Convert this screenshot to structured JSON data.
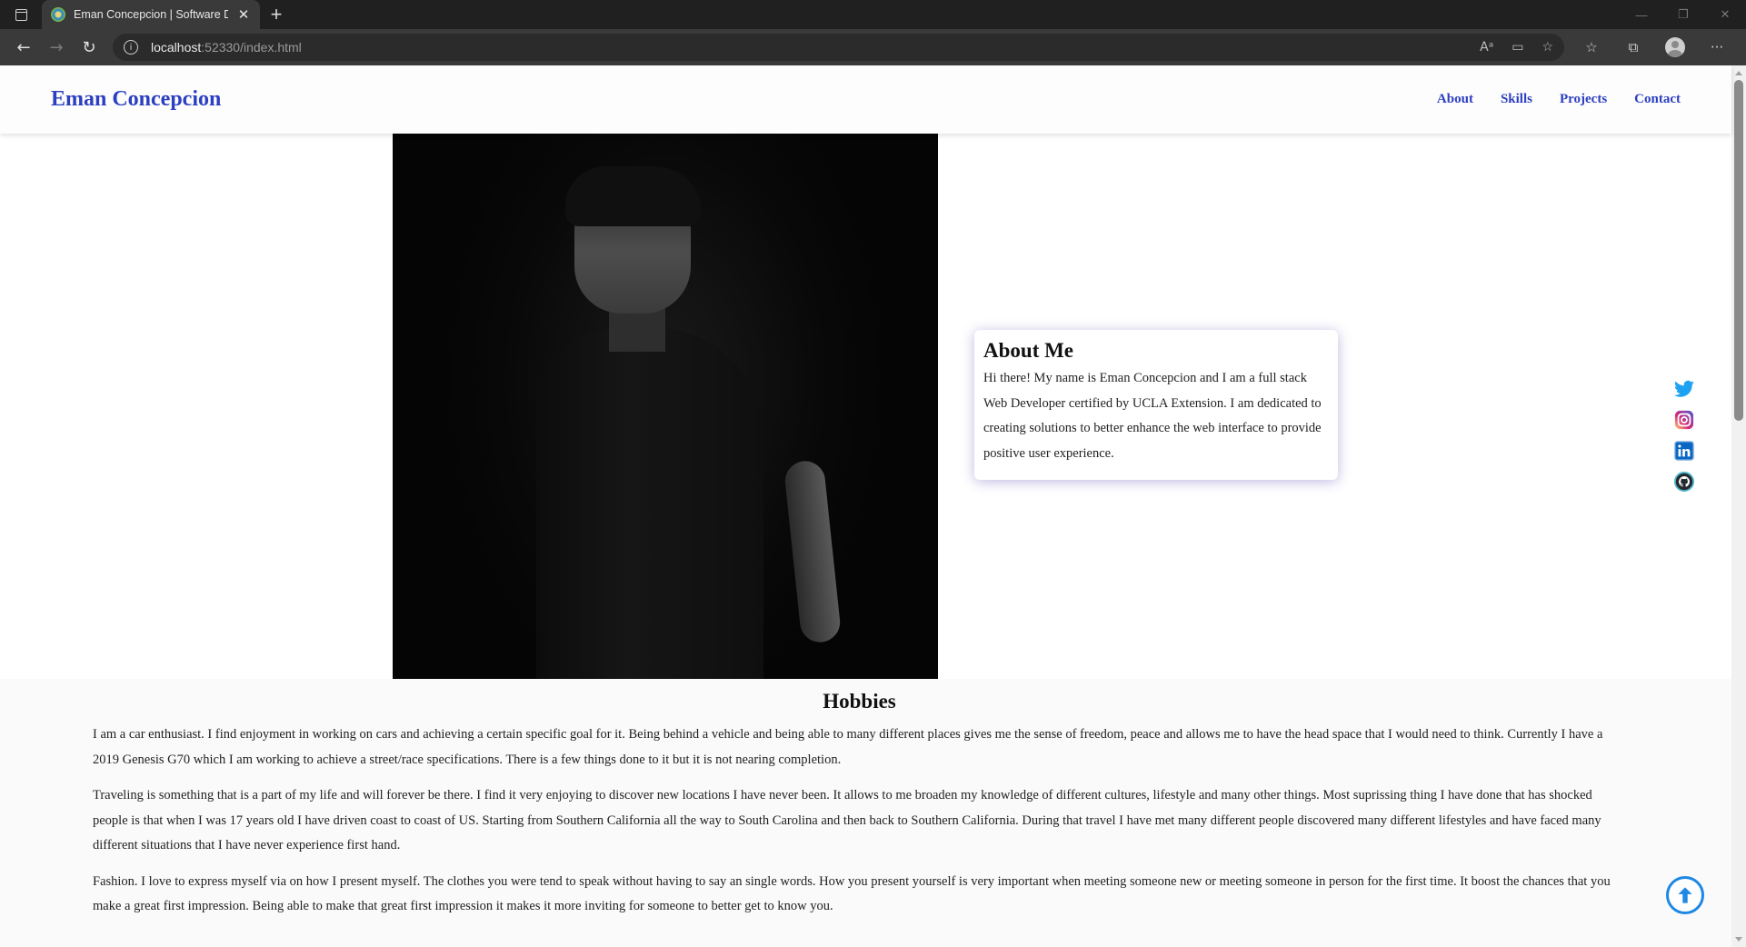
{
  "browser": {
    "tab_title": "Eman Concepcion | Software De",
    "tab_close": "✕",
    "new_tab": "+",
    "url_host": "localhost",
    "url_rest": ":52330/index.html",
    "win_minimize": "—",
    "win_restore": "❐",
    "win_close": "✕",
    "back": "←",
    "forward": "→",
    "reload": "↻",
    "menu": "···"
  },
  "site": {
    "brand": "Eman Concepcion",
    "nav": [
      "About",
      "Skills",
      "Projects",
      "Contact"
    ]
  },
  "about": {
    "title": "About Me",
    "text": "Hi there! My name is Eman Concepcion and I am a full stack Web Developer certified by UCLA Extension. I am dedicated to creating solutions to better enhance the web interface to provide positive user experience."
  },
  "social": {
    "icons": [
      "twitter-icon",
      "instagram-icon",
      "linkedin-icon",
      "github-icon"
    ],
    "colors": {
      "twitter": "#1da1f2",
      "instagram": "#e1306c",
      "linkedin": "#0a66c2",
      "github": "#24292e"
    }
  },
  "hobbies": {
    "title": "Hobbies",
    "paragraphs": [
      "I am a car enthusiast. I find enjoyment in working on cars and achieving a certain specific goal for it. Being behind a vehicle and being able to many different places gives me the sense of freedom, peace and allows me to have the head space that I would need to think. Currently I have a 2019 Genesis G70 which I am working to achieve a street/race specifications. There is a few things done to it but it is not nearing completion.",
      "Traveling is something that is a part of my life and will forever be there. I find it very enjoying to discover new locations I have never been. It allows to me broaden my knowledge of different cultures, lifestyle and many other things. Most suprissing thing I have done that has shocked people is that when I was 17 years old I have driven coast to coast of US. Starting from Southern California all the way to South Carolina and then back to Southern California. During that travel I have met many different people discovered many different lifestyles and have faced many different situations that I have never experience first hand.",
      "Fashion. I love to express myself via on how I present myself. The clothes you were tend to speak without having to say an single words. How you present yourself is very important when meeting someone new or meeting someone in person for the first time. It boost the chances that you make a great first impression. Being able to make that great first impression it makes it more inviting for someone to better get to know you."
    ]
  },
  "colors": {
    "brand_blue": "#2c3fc0",
    "scroll_top_blue": "#1e88e5"
  }
}
